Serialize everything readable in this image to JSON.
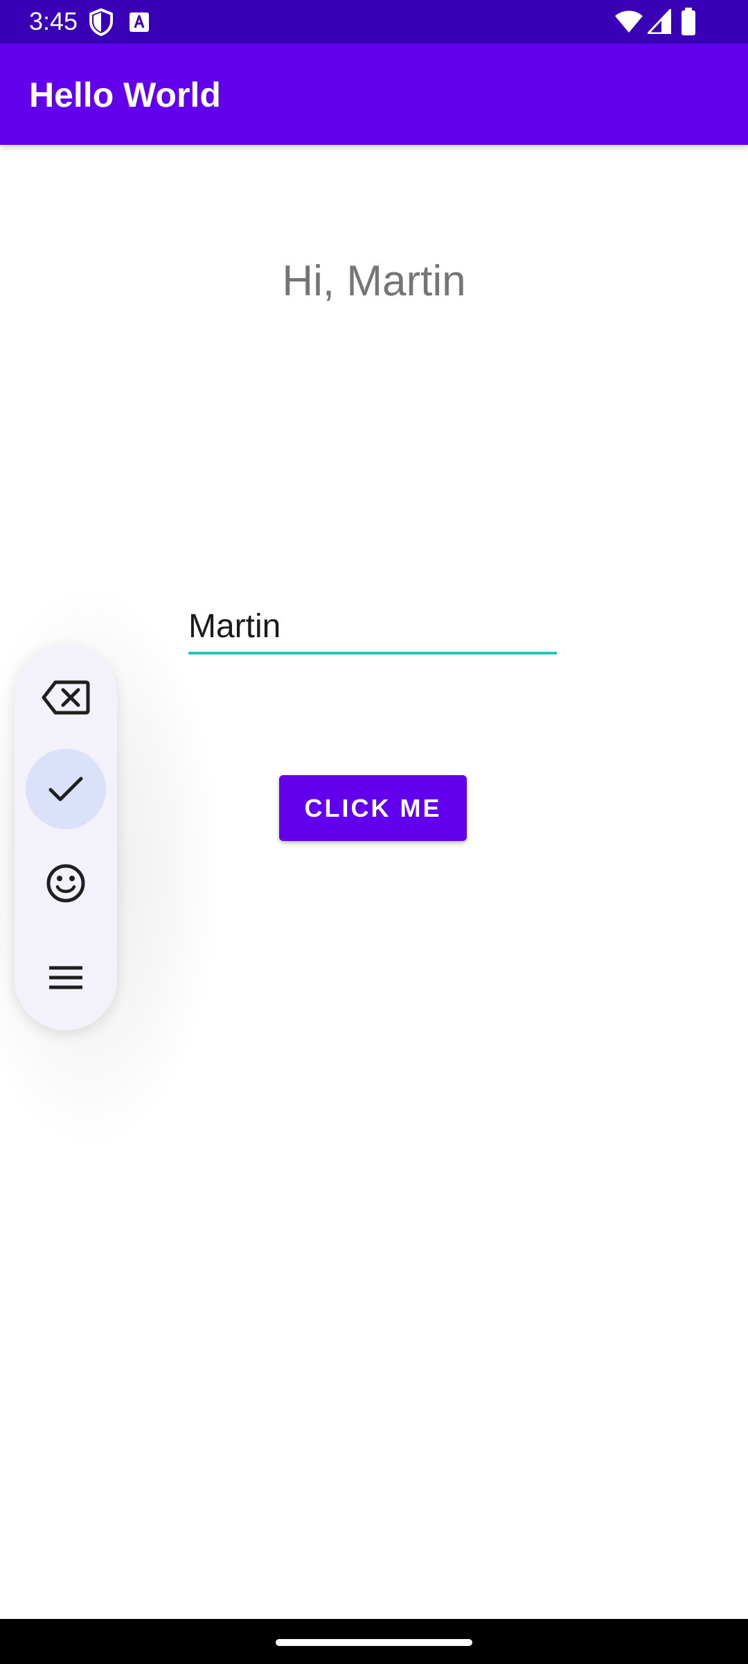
{
  "status_bar": {
    "time": "3:45",
    "icons": [
      "shield-icon",
      "keyboard-a-icon",
      "wifi-icon",
      "signal-icon",
      "battery-icon"
    ]
  },
  "app_bar": {
    "title": "Hello World"
  },
  "greeting": {
    "text": "Hi, Martin"
  },
  "name_input": {
    "value": "Martin"
  },
  "button": {
    "label": "CLICK ME"
  },
  "floating_toolbar": {
    "items": [
      "backspace-icon",
      "check-icon",
      "emoji-icon",
      "menu-icon"
    ],
    "selected": "check-icon"
  },
  "colors": {
    "status_bar": "#3a00b5",
    "app_bar": "#6200ee",
    "accent": "#26c6bd",
    "greeting_text": "#757575",
    "toolbar_bg": "#f3f2fb",
    "toolbar_selected": "#dbe1f9"
  }
}
